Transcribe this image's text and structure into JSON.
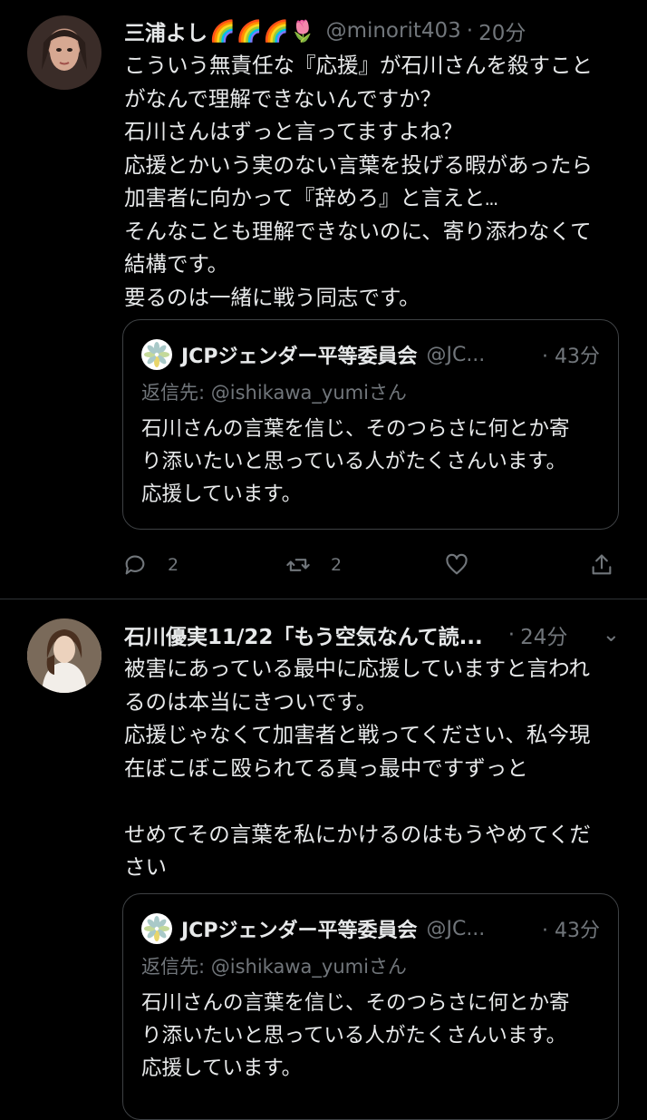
{
  "tweet1": {
    "name": "三浦よし",
    "emoji": "🌈🌈🌈🌷",
    "handle": "@minorit403",
    "time": "20分",
    "text": "こういう無責任な『応援』が石川さんを殺すこと\nがなんで理解できないんですか？\n石川さんはずっと言ってますよね？\n応援とかいう実のない言葉を投げる暇があったら\n加害者に向かって『辞めろ』と言えと…\nそんなことも理解できないのに、寄り添わなくて\n結構です。\n要るのは一緒に戦う同志です。",
    "quote": {
      "name": "JCPジェンダー平等委員会",
      "handle": "@JC...",
      "time": "· 43分",
      "reply_label": "返信先: ",
      "reply_mention": "@ishikawa_yumi",
      "reply_suffix": "さん",
      "text": "石川さんの言葉を信じ、そのつらさに何とか寄\nり添いたいと思っている人がたくさんいます。\n応援しています。"
    },
    "actions": {
      "reply_count": "2",
      "retweet_count": "2"
    }
  },
  "tweet2": {
    "name": "石川優実11/22「もう空気なんて読...",
    "time": "24分",
    "text": "被害にあっている最中に応援していますと言われ\nるのは本当にきついです。\n応援じゃなくて加害者と戦ってください、私今現\n在ぼこぼこ殴られてる真っ最中ですずっと\n\nせめてその言葉を私にかけるのはもうやめてくだ\nさい",
    "quote": {
      "name": "JCPジェンダー平等委員会",
      "handle": "@JC...",
      "time": "· 43分",
      "reply_label": "返信先: ",
      "reply_mention": "@ishikawa_yumi",
      "reply_suffix": "さん",
      "text": "石川さんの言葉を信じ、そのつらさに何とか寄\nり添いたいと思っている人がたくさんいます。\n応援しています。"
    }
  },
  "colors": {
    "background": "#000000",
    "text": "#e7e9ea",
    "muted": "#71767b",
    "border": "#3e4144"
  },
  "icons": [
    "reply-icon",
    "retweet-icon",
    "like-icon",
    "share-icon",
    "jcp-flower-logo-icon"
  ]
}
